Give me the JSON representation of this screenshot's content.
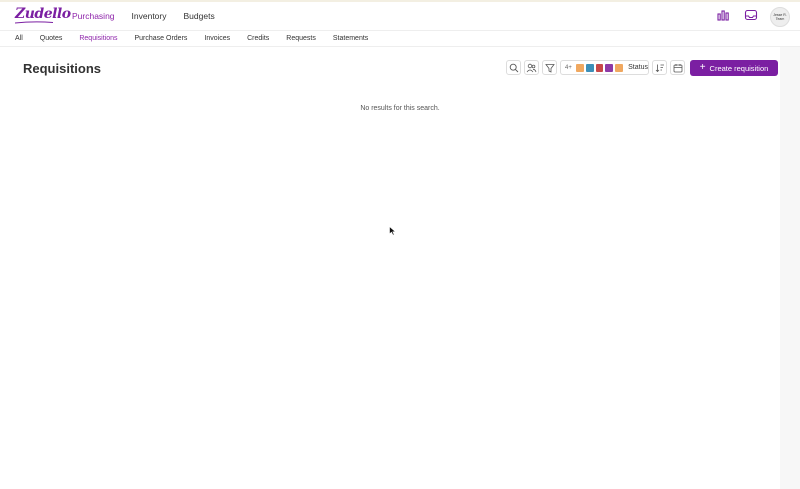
{
  "app": {
    "logo_text": "Zudello",
    "brand_color": "#7b1fa2"
  },
  "main_nav": {
    "items": [
      {
        "label": "Purchasing",
        "active": true
      },
      {
        "label": "Inventory",
        "active": false
      },
      {
        "label": "Budgets",
        "active": false
      }
    ]
  },
  "top_icons": [
    "chart-icon",
    "inbox-icon"
  ],
  "avatar": {
    "text": "Jesse R. Team"
  },
  "sub_nav": {
    "items": [
      {
        "label": "All",
        "active": false
      },
      {
        "label": "Quotes",
        "active": false
      },
      {
        "label": "Requisitions",
        "active": true
      },
      {
        "label": "Purchase Orders",
        "active": false
      },
      {
        "label": "Invoices",
        "active": false
      },
      {
        "label": "Credits",
        "active": false
      },
      {
        "label": "Requests",
        "active": false
      },
      {
        "label": "Statements",
        "active": false
      }
    ]
  },
  "page": {
    "title": "Requisitions",
    "empty_message": "No results for this search."
  },
  "toolbar": {
    "search_icon": "search-icon",
    "users_icon": "users-icon",
    "filter_icon": "filter-icon",
    "status_filter": {
      "count": "4+",
      "label": "Status",
      "swatches": [
        "#f0a860",
        "#3c8fb8",
        "#c84848",
        "#8e3aa6",
        "#f0a860"
      ]
    },
    "sort_icon": "sort-icon",
    "calendar_icon": "calendar-icon",
    "create_label": "Create requisition"
  }
}
